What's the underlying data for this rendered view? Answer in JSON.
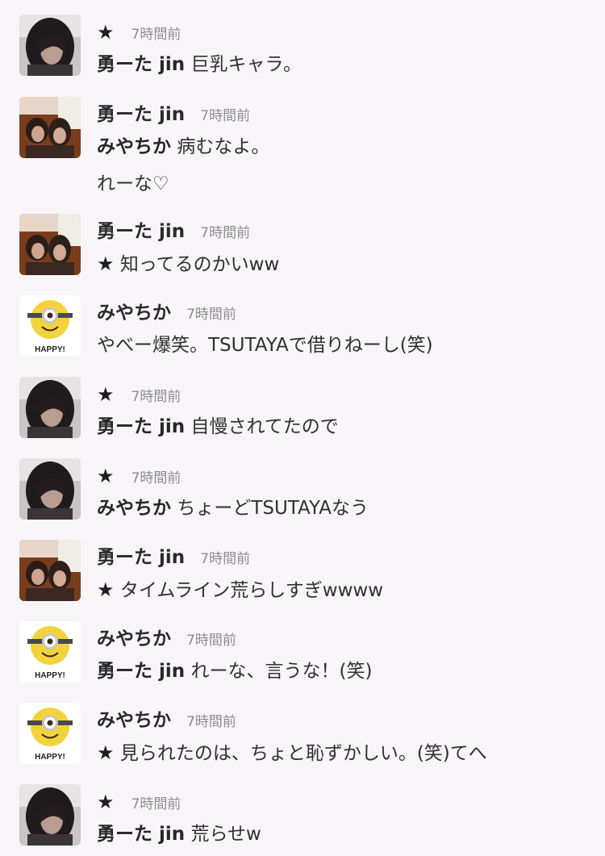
{
  "feed": [
    {
      "avatar": "dark-hair-selfie",
      "header": {
        "type": "star",
        "star": "★",
        "time": "7時間前"
      },
      "message": {
        "lead": "勇ーた jin",
        "text": "巨乳キャラ。"
      }
    },
    {
      "avatar": "two-friends",
      "header": {
        "type": "name",
        "name": "勇ーた jin",
        "time": "7時間前"
      },
      "message": {
        "lead": "みやちか",
        "text": "病むなよ。"
      },
      "extra": "れーな♡"
    },
    {
      "avatar": "two-friends",
      "header": {
        "type": "name",
        "name": "勇ーた jin",
        "time": "7時間前"
      },
      "message": {
        "lead": "★",
        "text": "知ってるのかいww"
      }
    },
    {
      "avatar": "minion-happy",
      "header": {
        "type": "name",
        "name": "みやちか",
        "time": "7時間前"
      },
      "message": {
        "lead": "",
        "text": "やべー爆笑。TSUTAYAで借りねーし(笑)"
      }
    },
    {
      "avatar": "dark-hair-selfie",
      "header": {
        "type": "star",
        "star": "★",
        "time": "7時間前"
      },
      "message": {
        "lead": "勇ーた jin",
        "text": "自慢されてたので"
      }
    },
    {
      "avatar": "dark-hair-selfie",
      "header": {
        "type": "star",
        "star": "★",
        "time": "7時間前"
      },
      "message": {
        "lead": "みやちか",
        "text": "ちょーどTSUTAYAなう"
      }
    },
    {
      "avatar": "two-friends",
      "header": {
        "type": "name",
        "name": "勇ーた jin",
        "time": "7時間前"
      },
      "message": {
        "lead": "★",
        "text": "タイムライン荒らしすぎwwww"
      }
    },
    {
      "avatar": "minion-happy",
      "header": {
        "type": "name",
        "name": "みやちか",
        "time": "7時間前"
      },
      "message": {
        "lead": "勇ーた jin",
        "text": "れーな、言うな！(笑)"
      }
    },
    {
      "avatar": "minion-happy",
      "header": {
        "type": "name",
        "name": "みやちか",
        "time": "7時間前"
      },
      "message": {
        "lead": "★",
        "text": "見られたのは、ちょと恥ずかしい。(笑)てへ"
      }
    },
    {
      "avatar": "dark-hair-selfie",
      "header": {
        "type": "star",
        "star": "★",
        "time": "7時間前"
      },
      "message": {
        "lead": "勇ーた jin",
        "text": "荒らせw"
      }
    }
  ],
  "avatars": {
    "minion-happy": {
      "badge": "HAPPY!"
    }
  }
}
